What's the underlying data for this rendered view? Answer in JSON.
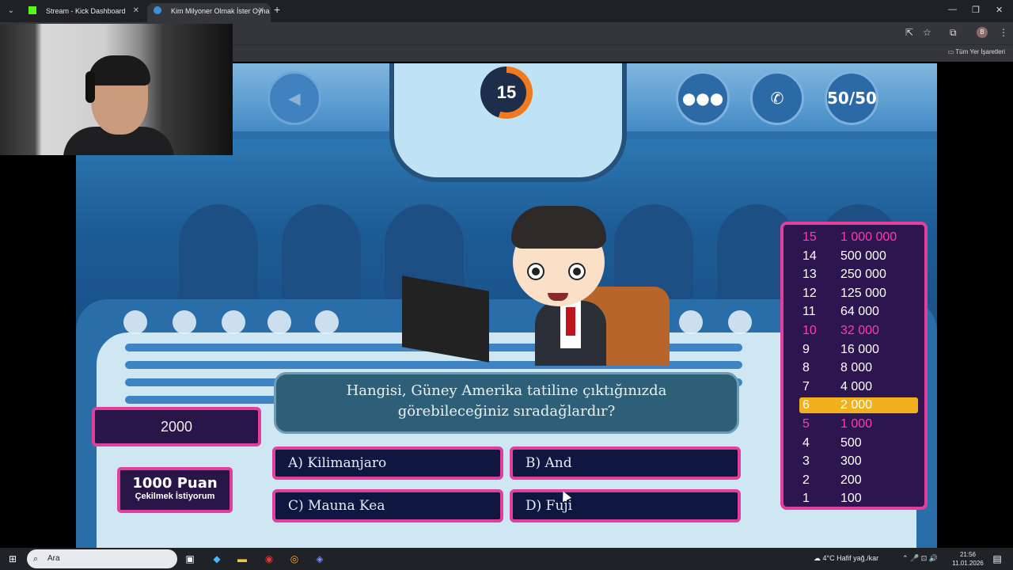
{
  "browser": {
    "tabs": [
      {
        "title": "Stream - Kick Dashboard",
        "favicon": "kick-icon",
        "active": false
      },
      {
        "title": "Kim Milyoner Olmak İster Oyna",
        "favicon": "game-icon",
        "active": true
      }
    ],
    "bookmarks_label": "Tüm Yer İşaretleri",
    "profile_initial": "B"
  },
  "game": {
    "timer": "15",
    "lifelines": {
      "audience": "audience-icon",
      "phone": "phone-icon",
      "fifty": "50/50"
    },
    "score": "2000",
    "withdraw": {
      "line1": "1000 Puan",
      "line2": "Çekilmek İstiyorum"
    },
    "question": "Hangisi, Güney Amerika tatiline çıktığınızda görebileceğiniz sıradağlardır?",
    "answers": [
      "A) Kilimanjaro",
      "B) And",
      "C) Mauna Kea",
      "D) Fuji"
    ],
    "ladder": [
      {
        "level": "15",
        "amount": "1 000 000",
        "milestone": true,
        "current": false
      },
      {
        "level": "14",
        "amount": "500 000",
        "milestone": false,
        "current": false
      },
      {
        "level": "13",
        "amount": "250 000",
        "milestone": false,
        "current": false
      },
      {
        "level": "12",
        "amount": "125 000",
        "milestone": false,
        "current": false
      },
      {
        "level": "11",
        "amount": "64 000",
        "milestone": false,
        "current": false
      },
      {
        "level": "10",
        "amount": "32 000",
        "milestone": true,
        "current": false
      },
      {
        "level": "9",
        "amount": "16 000",
        "milestone": false,
        "current": false
      },
      {
        "level": "8",
        "amount": "8 000",
        "milestone": false,
        "current": false
      },
      {
        "level": "7",
        "amount": "4 000",
        "milestone": false,
        "current": false
      },
      {
        "level": "6",
        "amount": "2 000",
        "milestone": false,
        "current": true
      },
      {
        "level": "5",
        "amount": "1 000",
        "milestone": true,
        "current": false
      },
      {
        "level": "4",
        "amount": "500",
        "milestone": false,
        "current": false
      },
      {
        "level": "3",
        "amount": "300",
        "milestone": false,
        "current": false
      },
      {
        "level": "2",
        "amount": "200",
        "milestone": false,
        "current": false
      },
      {
        "level": "1",
        "amount": "100",
        "milestone": false,
        "current": false
      }
    ],
    "colors": {
      "accent": "#e0409b",
      "milestone": "#ff3da6",
      "current": "#f2b11c",
      "timer": "#f07b1e"
    }
  },
  "taskbar": {
    "search_placeholder": "Ara",
    "weather": "4°C  Hafif yağ./kar",
    "time": "21:56",
    "date": "11.01.2026"
  }
}
